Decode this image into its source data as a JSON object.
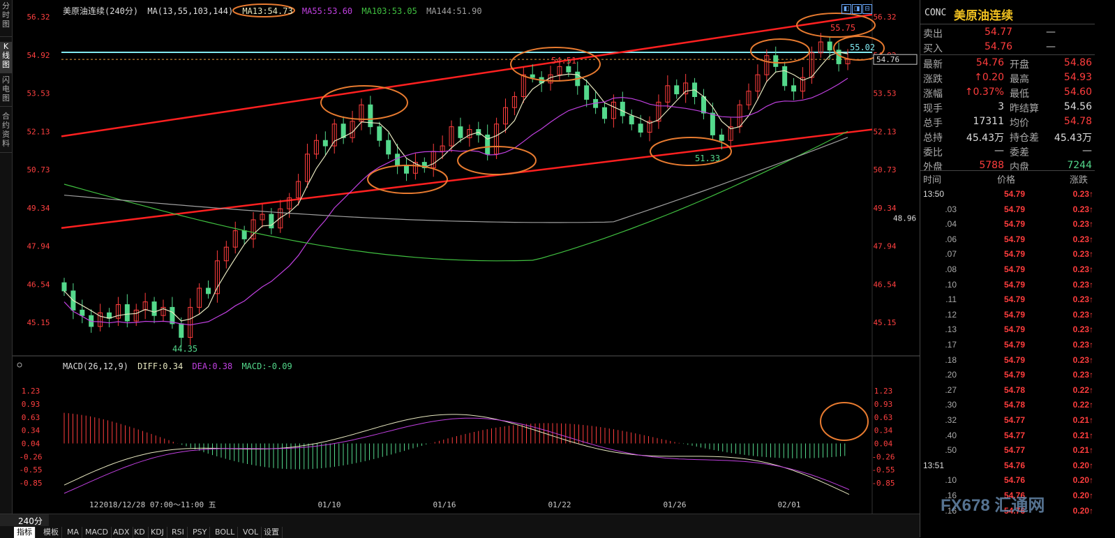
{
  "sidebar_tabs": [
    "分时图",
    "K线图",
    "闪电图",
    "合约资料"
  ],
  "header": {
    "title": "美原油连续(240分)",
    "ma_spec": "MA(13,55,103,144)",
    "ma13": "MA13:54.73",
    "ma55": "MA55:53.60",
    "ma103": "MA103:53.05",
    "ma144": "MA144:51.90"
  },
  "macd_header": {
    "spec": "MACD(26,12,9)",
    "diff": "DIFF:0.34",
    "dea": "DEA:0.38",
    "macd": "MACD:-0.09"
  },
  "price_axis": [
    "56.32",
    "54.92",
    "53.53",
    "52.13",
    "50.73",
    "49.34",
    "47.94",
    "46.54",
    "45.15"
  ],
  "macd_axis": [
    "1.23",
    "0.93",
    "0.63",
    "0.34",
    "0.04",
    "-0.26",
    "-0.55",
    "-0.85"
  ],
  "price_tags": {
    "current": "54.76",
    "ma_value": "48.96"
  },
  "annotations": {
    "high": "55.75",
    "peak1": "54.51",
    "low": "44.35",
    "low2": "51.33",
    "level": "55.02"
  },
  "x_labels": [
    "12",
    "2018/12/28 07:00～11:00 五",
    "01/10",
    "01/16",
    "01/22",
    "01/26",
    "02/01"
  ],
  "period_label": "240分",
  "bottom_tabs": [
    "指标",
    "模板",
    "MA",
    "MACD",
    "ADX",
    "KD",
    "KDJ",
    "RSI",
    "PSY",
    "BOLL",
    "VOL",
    "设置"
  ],
  "quote": {
    "symbol": "CONC",
    "name": "美原油连续",
    "sell_label": "卖出",
    "sell": "54.77",
    "sell_vol": "—",
    "buy_label": "买入",
    "buy": "54.76",
    "buy_vol": "—",
    "rows": [
      {
        "l1": "最新",
        "v1": "54.76",
        "l2": "开盘",
        "v2": "54.86"
      },
      {
        "l1": "涨跌",
        "v1": "↑0.20",
        "l2": "最高",
        "v2": "54.93"
      },
      {
        "l1": "涨幅",
        "v1": "↑0.37%",
        "l2": "最低",
        "v2": "54.60"
      },
      {
        "l1": "现手",
        "v1": "3",
        "l2": "昨结算",
        "v2": "54.56"
      },
      {
        "l1": "总手",
        "v1": "17311",
        "l2": "均价",
        "v2": "54.78"
      },
      {
        "l1": "总持",
        "v1": "45.43万",
        "l2": "持仓差",
        "v2": "45.43万"
      },
      {
        "l1": "委比",
        "v1": "—",
        "l2": "委差",
        "v2": "—"
      },
      {
        "l1": "外盘",
        "v1": "5788",
        "l2": "内盘",
        "v2": "7244"
      }
    ],
    "trade_headers": [
      "时间",
      "价格",
      "涨跌"
    ],
    "trades": [
      {
        "t": "13:50",
        "p": "54.79",
        "c": "0.23↑"
      },
      {
        "t": ".03",
        "p": "54.79",
        "c": "0.23↑"
      },
      {
        "t": ".04",
        "p": "54.79",
        "c": "0.23↑"
      },
      {
        "t": ".06",
        "p": "54.79",
        "c": "0.23↑"
      },
      {
        "t": ".07",
        "p": "54.79",
        "c": "0.23↑"
      },
      {
        "t": ".08",
        "p": "54.79",
        "c": "0.23↑"
      },
      {
        "t": ".10",
        "p": "54.79",
        "c": "0.23↑"
      },
      {
        "t": ".11",
        "p": "54.79",
        "c": "0.23↑"
      },
      {
        "t": ".12",
        "p": "54.79",
        "c": "0.23↑"
      },
      {
        "t": ".13",
        "p": "54.79",
        "c": "0.23↑"
      },
      {
        "t": ".17",
        "p": "54.79",
        "c": "0.23↑"
      },
      {
        "t": ".18",
        "p": "54.79",
        "c": "0.23↑"
      },
      {
        "t": ".20",
        "p": "54.79",
        "c": "0.23↑"
      },
      {
        "t": ".27",
        "p": "54.78",
        "c": "0.22↑"
      },
      {
        "t": ".30",
        "p": "54.78",
        "c": "0.22↑"
      },
      {
        "t": ".32",
        "p": "54.77",
        "c": "0.21↑"
      },
      {
        "t": ".40",
        "p": "54.77",
        "c": "0.21↑"
      },
      {
        "t": ".50",
        "p": "54.77",
        "c": "0.21↑"
      },
      {
        "t": "13:51",
        "p": "54.76",
        "c": "0.20↑"
      },
      {
        "t": ".10",
        "p": "54.76",
        "c": "0.20↑"
      },
      {
        "t": ".16",
        "p": "54.76",
        "c": "0.20↑"
      },
      {
        "t": ".16",
        "p": "54.76",
        "c": "0.20↑"
      }
    ]
  },
  "watermark": "FX678 汇通网",
  "colors": {
    "up": "#ff3d3d",
    "down": "#54d98c",
    "ma13": "#e8e8c0",
    "ma55": "#c040e0",
    "ma103": "#40c040",
    "ma144": "#a0a0a0",
    "trend": "#ff2020",
    "level": "#80e8f0",
    "circle": "#e87b30",
    "axis": "#ff4040"
  },
  "chart_data": {
    "type": "candlestick",
    "title": "美原油连续(240分)",
    "ylim": [
      44.0,
      56.6
    ],
    "series": [
      {
        "name": "MA13",
        "last": 54.73
      },
      {
        "name": "MA55",
        "last": 53.6
      },
      {
        "name": "MA103",
        "last": 53.05
      },
      {
        "name": "MA144",
        "last": 51.9
      }
    ],
    "candles_close": [
      46.3,
      45.6,
      45.4,
      45.0,
      45.5,
      45.3,
      45.8,
      45.2,
      45.6,
      45.9,
      45.4,
      45.7,
      45.1,
      44.6,
      45.7,
      46.4,
      46.2,
      47.4,
      47.9,
      48.5,
      48.2,
      48.9,
      49.1,
      48.6,
      49.3,
      49.7,
      50.3,
      51.3,
      51.8,
      51.6,
      52.4,
      51.9,
      52.5,
      53.1,
      52.3,
      51.8,
      51.3,
      50.9,
      50.6,
      51.0,
      50.8,
      51.4,
      51.6,
      52.3,
      51.9,
      52.2,
      52.0,
      51.3,
      52.4,
      53.0,
      53.4,
      54.2,
      54.1,
      53.9,
      54.2,
      54.5,
      54.3,
      53.8,
      53.3,
      53.0,
      52.6,
      53.2,
      52.7,
      52.4,
      52.1,
      52.5,
      53.2,
      53.8,
      53.5,
      53.9,
      53.4,
      52.8,
      52.0,
      51.8,
      52.3,
      53.1,
      53.6,
      54.2,
      54.9,
      54.5,
      53.8,
      53.6,
      54.1,
      55.0,
      55.4,
      55.1,
      54.6,
      54.76
    ],
    "macd": {
      "diff": 0.34,
      "dea": 0.38,
      "macd": -0.09
    }
  }
}
